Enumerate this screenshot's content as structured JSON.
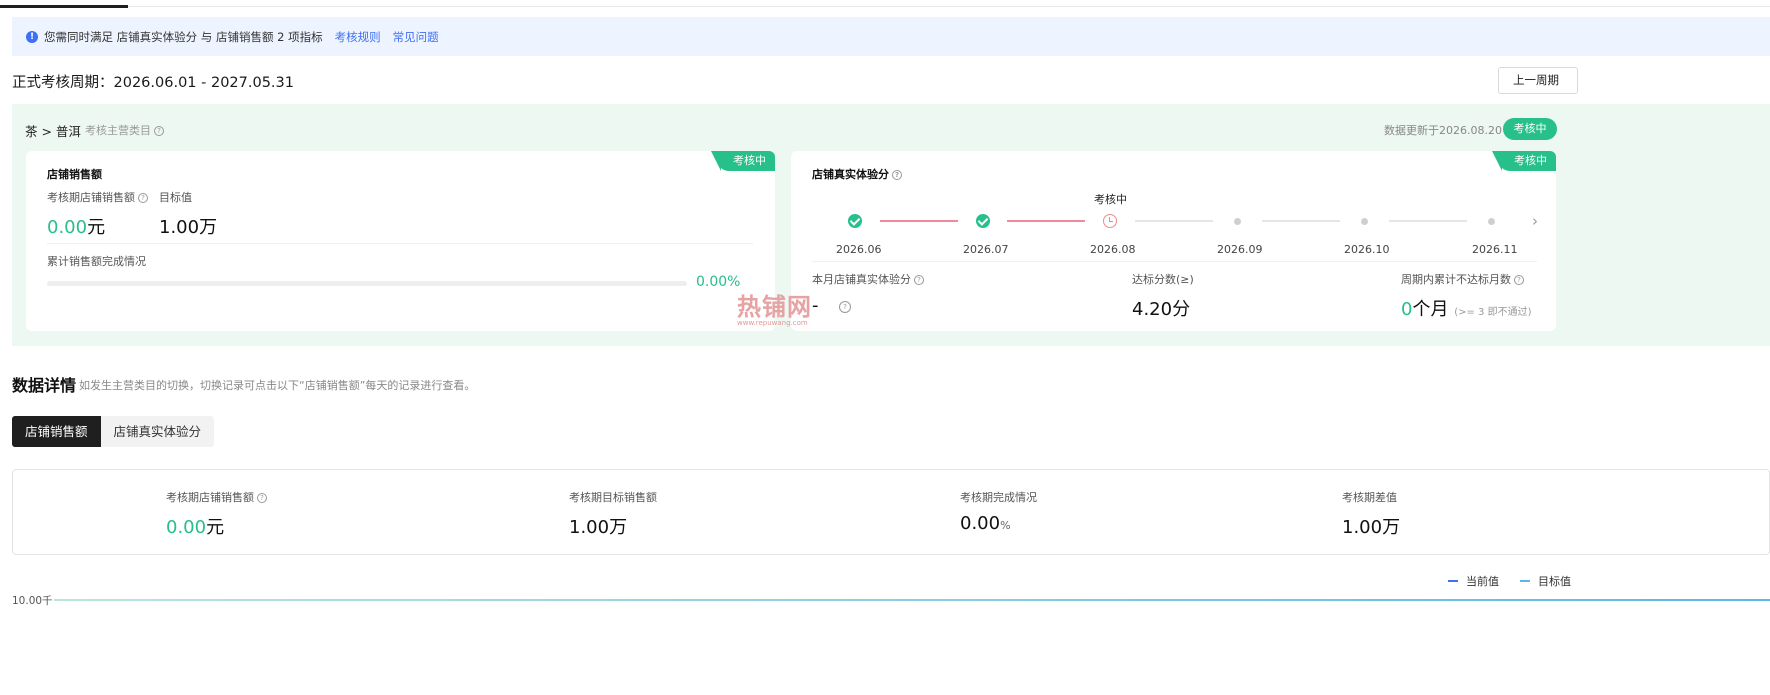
{
  "notice": {
    "text": "您需同时满足 店铺真实体验分 与 店铺销售额 2 项指标",
    "link_rules": "考核规则",
    "link_faq": "常见问题"
  },
  "period": {
    "label": "正式考核周期：2026.06.01 - 2027.05.31",
    "prev_button": "上一周期"
  },
  "category": {
    "path": "茶 > 普洱",
    "note": "考核主营类目",
    "updated": "数据更新于2026.08.20",
    "status": "考核中"
  },
  "sales_card": {
    "tag": "考核中",
    "title": "店铺销售额",
    "period_sales_label": "考核期店铺销售额",
    "period_sales_num": "0.00",
    "period_sales_unit": "元",
    "target_label": "目标值",
    "target_value": "1.00万",
    "cumulative_label": "累计销售额完成情况",
    "progress_pct": "0.00%",
    "progress_fraction": 0.0
  },
  "experience_card": {
    "tag": "考核中",
    "title": "店铺真实体验分",
    "timeline_current_label": "考核中",
    "months": [
      "2026.06",
      "2026.07",
      "2026.08",
      "2026.09",
      "2026.10",
      "2026.11"
    ],
    "month_score_label": "本月店铺真实体验分",
    "month_score_value": "-",
    "pass_score_label": "达标分数(≥)",
    "pass_score_value": "4.20分",
    "fail_months_label": "周期内累计不达标月数",
    "fail_months_num": "0",
    "fail_months_unit": "个月",
    "fail_months_note": "(>= 3 即不通过)"
  },
  "watermark": {
    "brand": "热铺网",
    "url": "www.repuwang.com"
  },
  "details": {
    "title": "数据详情",
    "subtitle": "如发生主营类目的切换，切换记录可点击以下“店铺销售额”每天的记录进行查看。",
    "tabs": [
      "店铺销售额",
      "店铺真实体验分"
    ],
    "stats": [
      {
        "label": "考核期店铺销售额",
        "num": "0.00",
        "unit": "元"
      },
      {
        "label": "考核期目标销售额",
        "num": "1.00万",
        "unit": ""
      },
      {
        "label": "考核期完成情况",
        "num": "0.00",
        "unit": "%"
      },
      {
        "label": "考核期差值",
        "num": "1.00万",
        "unit": ""
      }
    ]
  },
  "chart": {
    "legend_current": "当前值",
    "legend_target": "目标值",
    "y_tick_top": "10.00千",
    "colors": {
      "current": "#3f6ff5",
      "target": "#5bb8e8"
    }
  },
  "colors": {
    "accent_green": "#27c08b",
    "notice_bg": "#eef4ff",
    "link_blue": "#3f6ff5"
  }
}
